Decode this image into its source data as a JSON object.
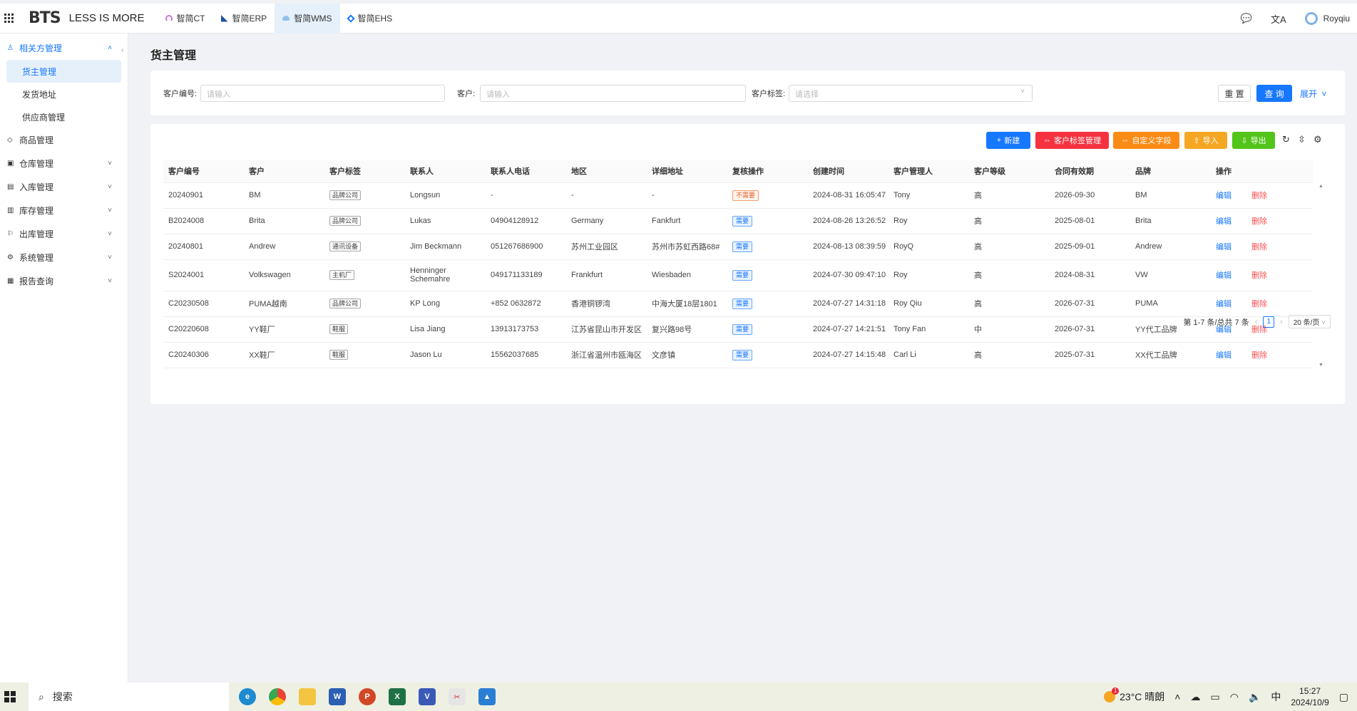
{
  "header": {
    "brand": "BTS",
    "tagline": "LESS IS MORE",
    "tabs": [
      {
        "label": "智简CT",
        "active": false,
        "color": "#c97bd3"
      },
      {
        "label": "智简ERP",
        "active": false,
        "color": "#1f4fa6"
      },
      {
        "label": "智简WMS",
        "active": true,
        "color": "#6aa7e0"
      },
      {
        "label": "智简EHS",
        "active": false,
        "color": "#1677ff"
      }
    ],
    "user": "Royqiu"
  },
  "sidebar": {
    "groups": [
      {
        "label": "相关方管理",
        "open": true,
        "items": [
          {
            "label": "货主管理",
            "active": true
          },
          {
            "label": "发货地址",
            "active": false
          },
          {
            "label": "供应商管理",
            "active": false
          }
        ]
      },
      {
        "label": "商品管理"
      },
      {
        "label": "仓库管理"
      },
      {
        "label": "入库管理"
      },
      {
        "label": "库存管理"
      },
      {
        "label": "出库管理"
      },
      {
        "label": "系统管理"
      },
      {
        "label": "报告查询"
      }
    ]
  },
  "page": {
    "title": "货主管理"
  },
  "filters": {
    "customer_code_label": "客户编号:",
    "customer_code_placeholder": "请输入",
    "customer_label": "客户:",
    "customer_placeholder": "请输入",
    "tag_label": "客户标签:",
    "tag_placeholder": "请选择",
    "reset": "重 置",
    "query": "查 询",
    "expand": "展开"
  },
  "toolbar": {
    "new": "新建",
    "tag_manage": "客户标签管理",
    "custom_field": "自定义字段",
    "import": "导入",
    "export": "导出",
    "colors": {
      "new": "#1677ff",
      "tag_manage": "#f5333f",
      "custom_field": "#fa8c16",
      "import": "#f5a623",
      "export": "#52c41a"
    }
  },
  "table": {
    "columns": [
      "客户编号",
      "客户",
      "客户标签",
      "联系人",
      "联系人电话",
      "地区",
      "详细地址",
      "复核操作",
      "创建时间",
      "客户管理人",
      "客户等级",
      "合同有效期",
      "品牌",
      "操作"
    ],
    "rows": [
      {
        "code": "20240901",
        "customer": "BM",
        "tag": "品牌公司",
        "contact": "Longsun",
        "phone": "-",
        "region": "-",
        "address": "-",
        "review": "不需要",
        "review_type": "no",
        "created": "2024-08-31 16:05:47",
        "manager": "Tony",
        "level": "高",
        "contract": "2026-09-30",
        "brand": "BM"
      },
      {
        "code": "B2024008",
        "customer": "Brita",
        "tag": "品牌公司",
        "contact": "Lukas",
        "phone": "04904128912",
        "region": "Germany",
        "address": "Fankfurt",
        "review": "需要",
        "review_type": "yes",
        "created": "2024-08-26 13:26:52",
        "manager": "Roy",
        "level": "高",
        "contract": "2025-08-01",
        "brand": "Brita"
      },
      {
        "code": "20240801",
        "customer": "Andrew",
        "tag": "通讯设备",
        "contact": "Jim Beckmann",
        "phone": "051267686900",
        "region": "苏州工业园区",
        "address": "苏州市苏虹西路68#",
        "review": "需要",
        "review_type": "yes",
        "created": "2024-08-13 08:39:59",
        "manager": "RoyQ",
        "level": "高",
        "contract": "2025-09-01",
        "brand": "Andrew"
      },
      {
        "code": "S2024001",
        "customer": "Volkswagen",
        "tag": "主机厂",
        "contact": "Henninger Schemahre",
        "phone": "049171133189",
        "region": "Frankfurt",
        "address": "Wiesbaden",
        "review": "需要",
        "review_type": "yes",
        "created": "2024-07-30 09:47:10",
        "manager": "Roy",
        "level": "高",
        "contract": "2024-08-31",
        "brand": "VW"
      },
      {
        "code": "C20230508",
        "customer": "PUMA越南",
        "tag": "品牌公司",
        "contact": "KP Long",
        "phone": "+852 0632872",
        "region": "香港铜锣湾",
        "address": "中海大厦18层1801",
        "review": "需要",
        "review_type": "yes",
        "created": "2024-07-27 14:31:18",
        "manager": "Roy Qiu",
        "level": "高",
        "contract": "2026-07-31",
        "brand": "PUMA"
      },
      {
        "code": "C20220608",
        "customer": "YY鞋厂",
        "tag": "鞋服",
        "contact": "Lisa Jiang",
        "phone": "13913173753",
        "region": "江苏省昆山市开发区",
        "address": "复兴路98号",
        "review": "需要",
        "review_type": "yes",
        "created": "2024-07-27 14:21:51",
        "manager": "Tony Fan",
        "level": "中",
        "contract": "2026-07-31",
        "brand": "YY代工品牌"
      },
      {
        "code": "C20240306",
        "customer": "XX鞋厂",
        "tag": "鞋服",
        "contact": "Jason Lu",
        "phone": "15562037685",
        "region": "浙江省温州市瓯海区",
        "address": "文彦镇",
        "review": "需要",
        "review_type": "yes",
        "created": "2024-07-27 14:15:48",
        "manager": "Carl Li",
        "level": "高",
        "contract": "2025-07-31",
        "brand": "XX代工品牌"
      }
    ],
    "edit_label": "编辑",
    "delete_label": "删除"
  },
  "pagination": {
    "summary": "第 1-7 条/总共 7 条",
    "page": "1",
    "page_size": "20 条/页"
  },
  "taskbar": {
    "search": "搜索",
    "weather": "23°C 晴朗",
    "weather_badge": "1",
    "ime": "中",
    "time": "15:27",
    "date": "2024/10/9"
  }
}
